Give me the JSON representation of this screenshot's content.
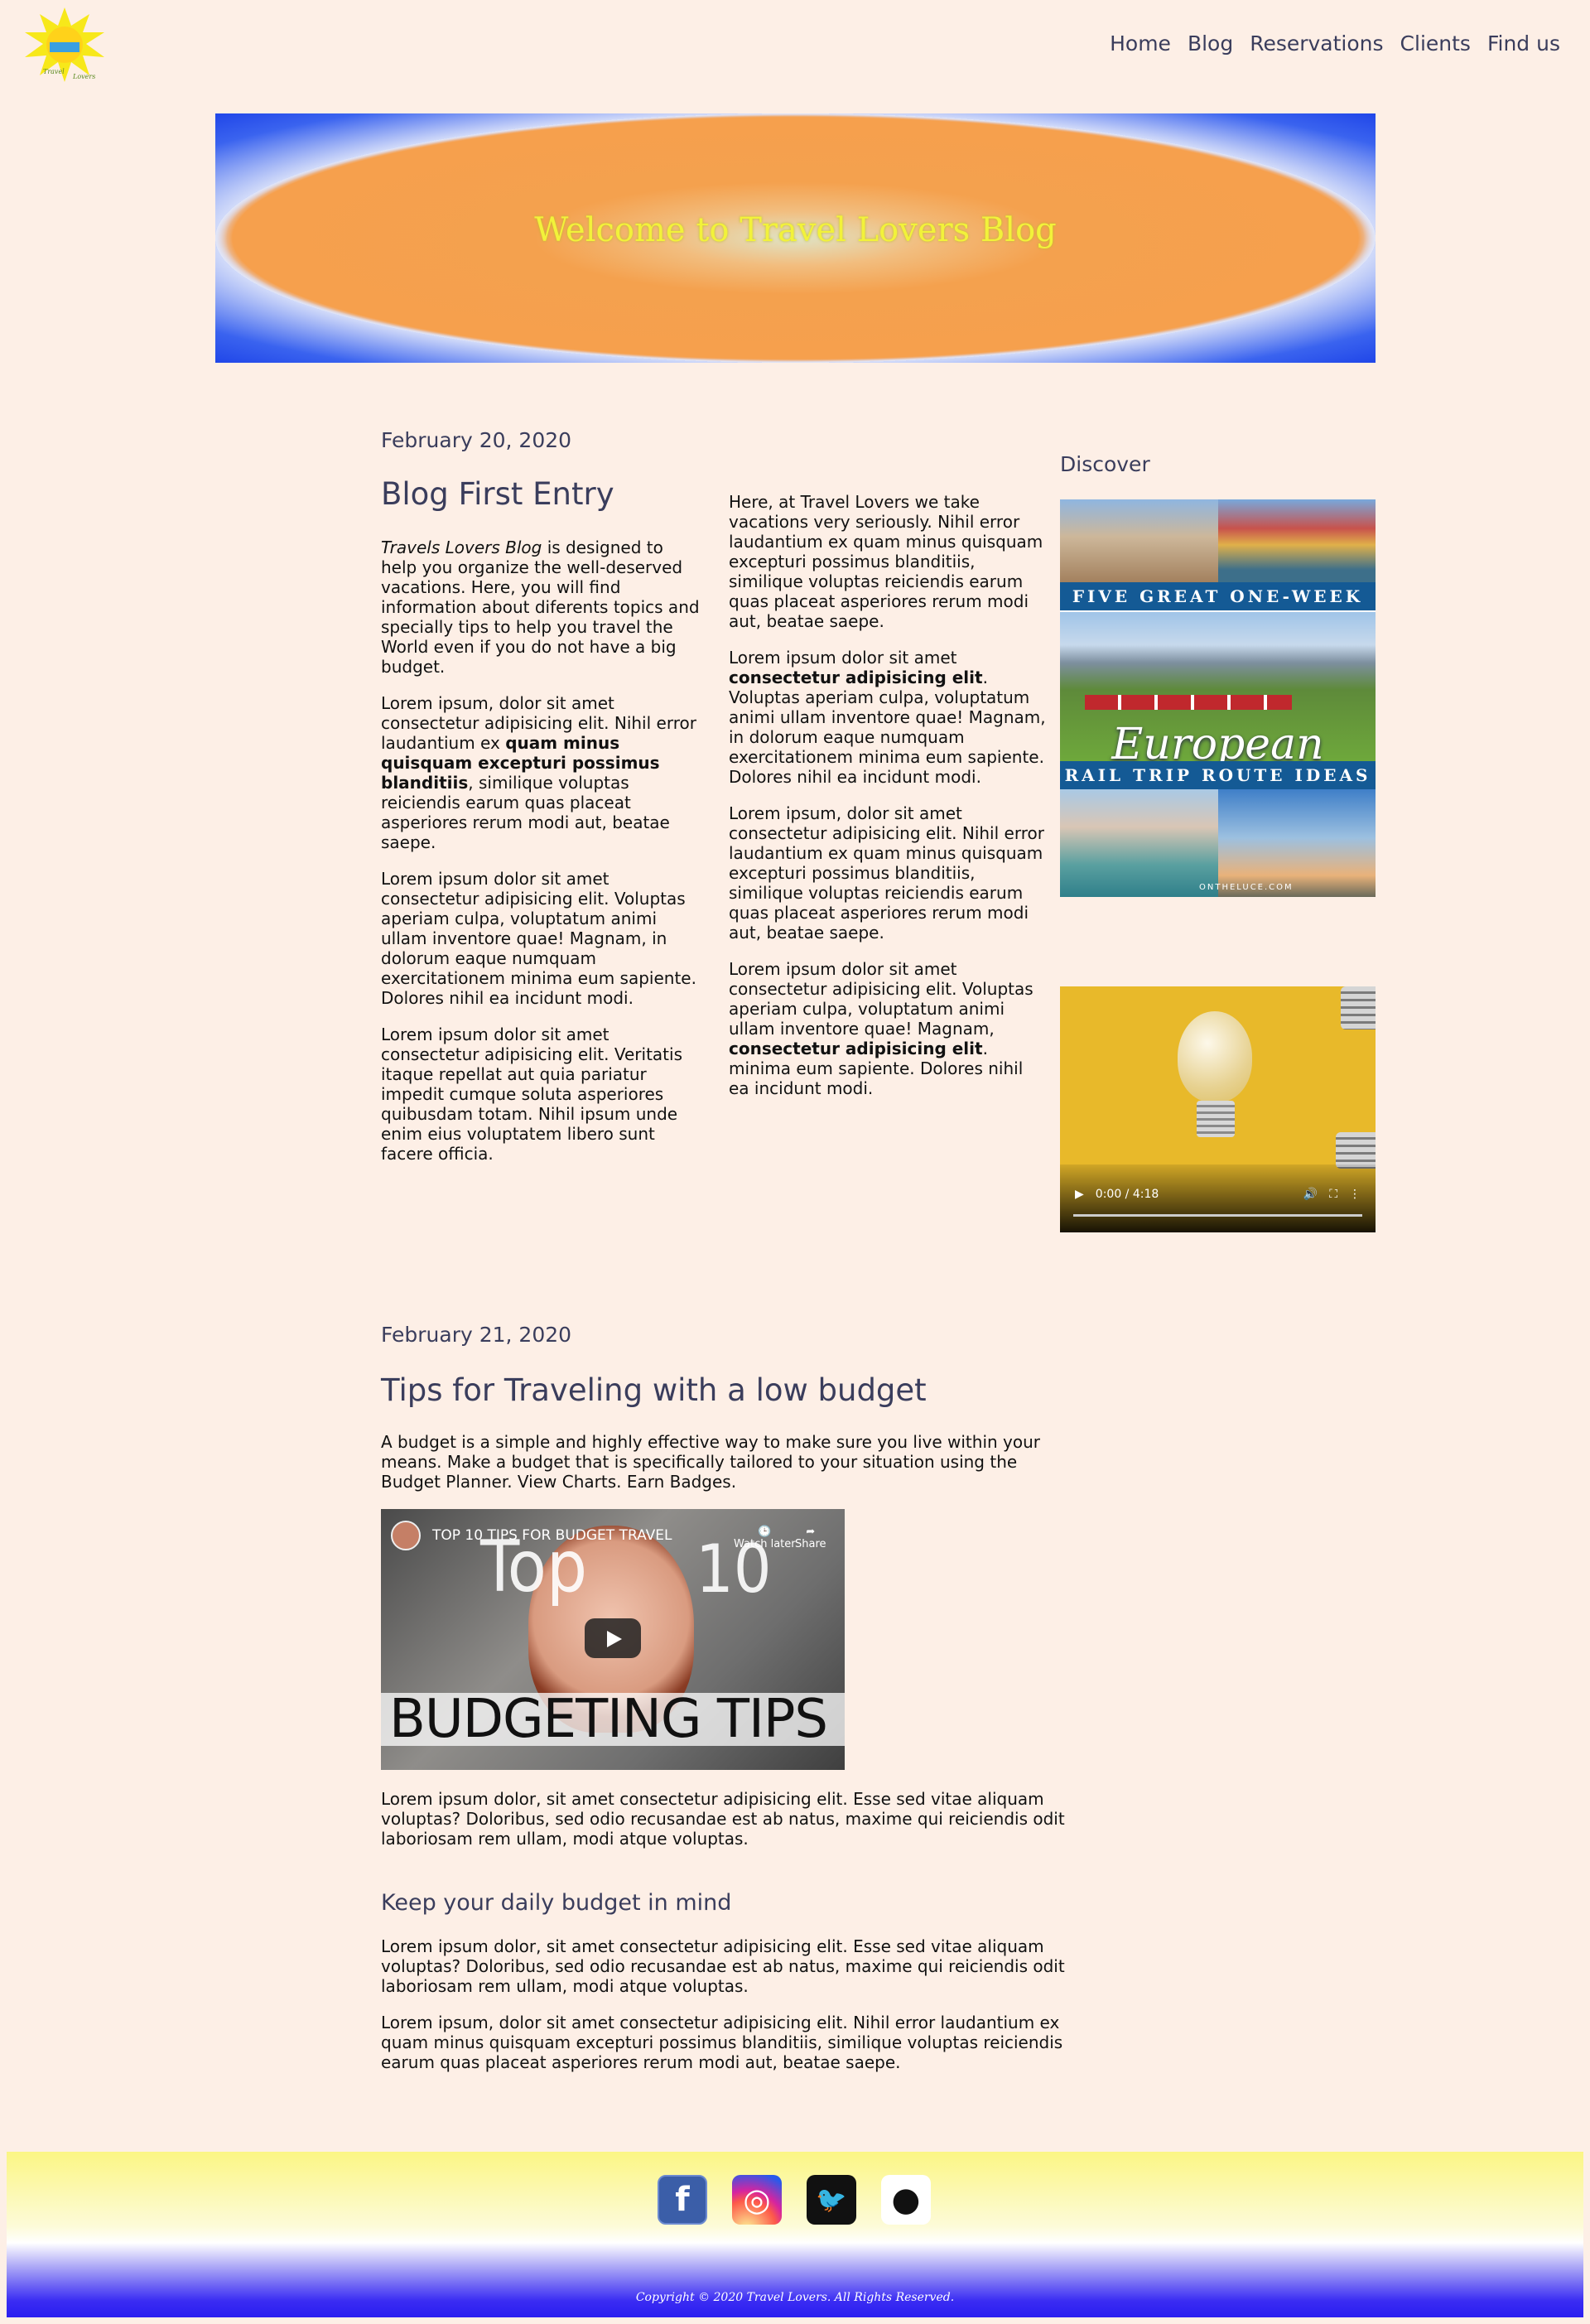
{
  "nav": {
    "items": [
      {
        "label": "Home"
      },
      {
        "label": "Blog"
      },
      {
        "label": "Reservations"
      },
      {
        "label": "Clients"
      },
      {
        "label": "Find us"
      }
    ]
  },
  "logo": {
    "icon": "sun-logo-icon",
    "text": "Travel Lovers"
  },
  "hero": {
    "title": "Welcome to Travel Lovers Blog",
    "title_color": "#f2f23a"
  },
  "post1": {
    "date": "February 20, 2020",
    "title": "Blog First Entry",
    "left": {
      "p1_em": "Travels Lovers Blog",
      "p1_rest": " is designed to help you organize the well-deserved vacations. Here, you will find information about diferents topics and specially tips to help you travel the World even if you do not have a big budget.",
      "p2_a": "Lorem ipsum, dolor sit amet consectetur adipisicing elit. Nihil error laudantium ex ",
      "p2_b": "quam minus quisquam excepturi possimus blanditiis",
      "p2_c": ", similique voluptas reiciendis earum quas placeat asperiores rerum modi aut, beatae saepe.",
      "p3": "Lorem ipsum dolor sit amet consectetur adipisicing elit. Voluptas aperiam culpa, voluptatum animi ullam inventore quae! Magnam, in dolorum eaque numquam exercitationem minima eum sapiente. Dolores nihil ea incidunt modi.",
      "p4": "Lorem ipsum dolor sit amet consectetur adipisicing elit. Veritatis itaque repellat aut quia pariatur impedit cumque soluta asperiores quibusdam totam. Nihil ipsum unde enim eius voluptatem libero sunt facere officia."
    },
    "right": {
      "p1": "Here, at Travel Lovers we take vacations very seriously. Nihil error laudantium ex quam minus quisquam excepturi possimus blanditiis, similique voluptas reiciendis earum quas placeat asperiores rerum modi aut, beatae saepe.",
      "p2_a": "Lorem ipsum dolor sit amet ",
      "p2_b": "consectetur adipisicing elit",
      "p2_c": ". Voluptas aperiam culpa, voluptatum animi ullam inventore quae! Magnam, in dolorum eaque numquam exercitationem minima eum sapiente. Dolores nihil ea incidunt modi.",
      "p3": "Lorem ipsum, dolor sit amet consectetur adipisicing elit. Nihil error laudantium ex quam minus quisquam excepturi possimus blanditiis, similique voluptas reiciendis earum quas placeat asperiores rerum modi aut, beatae saepe.",
      "p4_a": "Lorem ipsum dolor sit amet consectetur adipisicing elit. Voluptas aperiam culpa, voluptatum animi ullam inventore quae! Magnam, ",
      "p4_b": "consectetur adipisicing elit",
      "p4_c": ". minima eum sapiente. Dolores nihil ea incidunt modi."
    }
  },
  "sidebar": {
    "discover": "Discover",
    "pin_top": "FIVE GREAT ONE-WEEK",
    "pin_script": "European",
    "pin_bottom": "RAIL TRIP ROUTE IDEAS",
    "pin_credit": "ONTHELUCE.COM",
    "video_time": "0:00 / 4:18"
  },
  "post2": {
    "date": "February 21, 2020",
    "title": "Tips for Traveling with a low budget",
    "intro": "A budget is a simple and highly effective way to make sure you live within your means. Make a budget that is specifically tailored to your situation using the Budget Planner. View Charts. Earn Badges.",
    "yt": {
      "title": "TOP 10 TIPS FOR BUDGET TRAVEL",
      "watch_later": "Watch later",
      "share": "Share",
      "big_top_left": "Top",
      "big_top_right": "10",
      "bottom": "BUDGETING TIPS"
    },
    "after_video": "Lorem ipsum dolor, sit amet consectetur adipisicing elit. Esse sed vitae aliquam voluptas? Doloribus, sed odio recusandae est ab natus, maxime qui reiciendis odit laboriosam rem ullam, modi atque voluptas.",
    "subheading": "Keep your daily budget in mind",
    "p2": "Lorem ipsum dolor, sit amet consectetur adipisicing elit. Esse sed vitae aliquam voluptas? Doloribus, sed odio recusandae est ab natus, maxime qui reiciendis odit laboriosam rem ullam, modi atque voluptas.",
    "p3": "Lorem ipsum, dolor sit amet consectetur adipisicing elit. Nihil error laudantium ex quam minus quisquam excepturi possimus blanditiis, similique voluptas reiciendis earum quas placeat asperiores rerum modi aut, beatae saepe."
  },
  "footer": {
    "social": [
      {
        "icon": "facebook-icon",
        "glyph": "f",
        "bg": "#3b5ea8"
      },
      {
        "icon": "instagram-icon",
        "glyph": "◎",
        "bg": "#c13584"
      },
      {
        "icon": "twitter-icon",
        "glyph": "🐦",
        "bg": "#111111"
      },
      {
        "icon": "github-icon",
        "glyph": "●",
        "bg": "#ffffff"
      }
    ],
    "copyright": "Copyright © 2020 Travel Lovers. All Rights Reserved."
  }
}
